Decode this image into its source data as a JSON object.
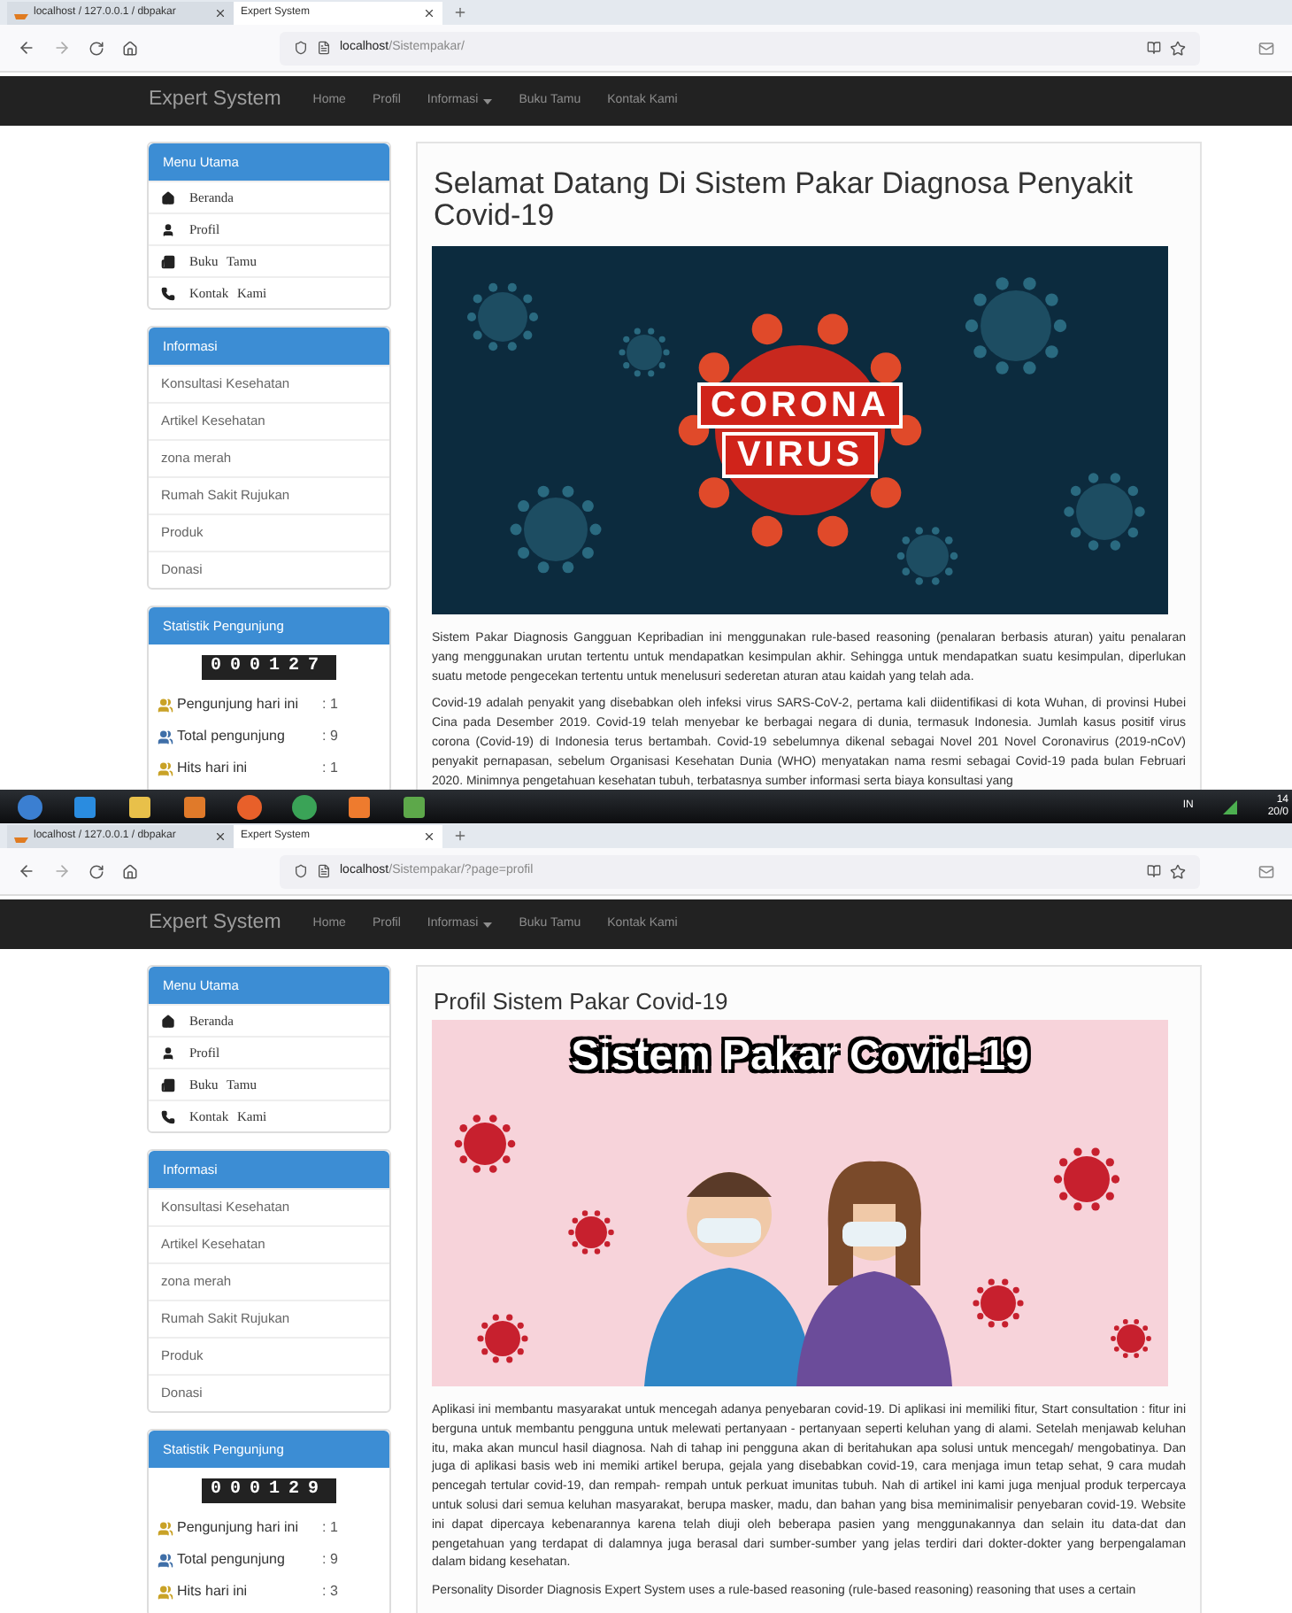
{
  "screens": [
    {
      "tabs": [
        {
          "label": "localhost / 127.0.0.1 / dbpakar",
          "selected": false
        },
        {
          "label": "Expert System",
          "selected": true
        }
      ],
      "url": {
        "host": "localhost",
        "path": "/Sistempakar/"
      },
      "navbar": {
        "brand": "Expert System",
        "links": [
          {
            "label": "Home",
            "dropdown": false
          },
          {
            "label": "Profil",
            "dropdown": false
          },
          {
            "label": "Informasi",
            "dropdown": true
          },
          {
            "label": "Buku Tamu",
            "dropdown": false
          },
          {
            "label": "Kontak Kami",
            "dropdown": false
          }
        ]
      },
      "sidebar": [
        {
          "kind": "menu",
          "title": "Menu Utama",
          "items": [
            {
              "label": "Beranda",
              "kind": "home"
            },
            {
              "label": "Profil",
              "kind": "user"
            },
            {
              "label": "Buku Tamu",
              "kind": "book"
            },
            {
              "label": "Kontak Kami",
              "kind": "phone"
            }
          ]
        },
        {
          "kind": "links",
          "title": "Informasi",
          "items": [
            {
              "label": "Konsultasi Kesehatan"
            },
            {
              "label": "Artikel Kesehatan"
            },
            {
              "label": "zona merah"
            },
            {
              "label": "Rumah Sakit Rujukan"
            },
            {
              "label": "Produk"
            },
            {
              "label": "Donasi"
            }
          ]
        },
        {
          "kind": "stats",
          "title": "Statistik Pengunjung",
          "counter": "000127",
          "rows": [
            {
              "label": "Pengunjung hari ini",
              "value": ": 1",
              "color": "#c9a227"
            },
            {
              "label": "Total pengunjung",
              "value": ": 9",
              "color": "#3f6fa8"
            },
            {
              "label": "Hits hari ini",
              "value": ": 1",
              "color": "#c9a227"
            }
          ]
        }
      ],
      "main": {
        "title": "Selamat Datang Di Sistem Pakar Diagnosa Penyakit Covid-19",
        "picture": {
          "kind": "corona",
          "text": [
            "CORONA",
            "VIRUS"
          ]
        },
        "paragraphs": [
          "Sistem Pakar Diagnosis Gangguan Kepribadian ini menggunakan rule-based reasoning (penalaran berbasis aturan) yaitu penalaran yang menggunakan urutan tertentu untuk mendapatkan kesimpulan akhir. Sehingga untuk mendapatkan suatu kesimpulan, diperlukan suatu metode pengecekan tertentu untuk menelusuri sederetan aturan atau kaidah yang telah ada.",
          "Covid-19 adalah penyakit yang disebabkan oleh infeksi virus SARS-CoV-2, pertama kali diidentifikasi di kota Wuhan, di provinsi Hubei Cina pada Desember 2019. Covid-19 telah menyebar ke berbagai negara di dunia, termasuk Indonesia. Jumlah kasus positif virus corona (Covid-19) di Indonesia terus bertambah. Covid-19 sebelumnya dikenal sebagai Novel 201 Novel Coronavirus (2019-nCoV) penyakit pernapasan, sebelum Organisasi Kesehatan Dunia (WHO) menyatakan nama resmi sebagai Covid-19 pada bulan Februari 2020. Minimnya pengetahuan kesehatan tubuh, terbatasnya sumber informasi serta biaya konsultasi yang"
        ]
      }
    },
    {
      "tabs": [
        {
          "label": "localhost / 127.0.0.1 / dbpakar",
          "selected": false
        },
        {
          "label": "Expert System",
          "selected": true
        }
      ],
      "url": {
        "host": "localhost",
        "path": "/Sistempakar/?page=profil"
      },
      "navbar": {
        "brand": "Expert System",
        "links": [
          {
            "label": "Home",
            "dropdown": false
          },
          {
            "label": "Profil",
            "dropdown": false
          },
          {
            "label": "Informasi",
            "dropdown": true
          },
          {
            "label": "Buku Tamu",
            "dropdown": false
          },
          {
            "label": "Kontak Kami",
            "dropdown": false
          }
        ]
      },
      "sidebar": [
        {
          "kind": "menu",
          "title": "Menu Utama",
          "items": [
            {
              "label": "Beranda",
              "kind": "home"
            },
            {
              "label": "Profil",
              "kind": "user"
            },
            {
              "label": "Buku Tamu",
              "kind": "book"
            },
            {
              "label": "Kontak Kami",
              "kind": "phone"
            }
          ]
        },
        {
          "kind": "links",
          "title": "Informasi",
          "items": [
            {
              "label": "Konsultasi Kesehatan"
            },
            {
              "label": "Artikel Kesehatan"
            },
            {
              "label": "zona merah"
            },
            {
              "label": "Rumah Sakit Rujukan"
            },
            {
              "label": "Produk"
            },
            {
              "label": "Donasi"
            }
          ]
        },
        {
          "kind": "stats",
          "title": "Statistik Pengunjung",
          "counter": "000129",
          "rows": [
            {
              "label": "Pengunjung hari ini",
              "value": ": 1",
              "color": "#c9a227"
            },
            {
              "label": "Total pengunjung",
              "value": ": 9",
              "color": "#3f6fa8"
            },
            {
              "label": "Hits hari ini",
              "value": ": 3",
              "color": "#c9a227"
            }
          ]
        }
      ],
      "main": {
        "title": "Profil Sistem Pakar Covid-19",
        "picture": {
          "kind": "profile",
          "text": [
            "Sistem Pakar Covid-19"
          ]
        },
        "paragraphs": [
          "Aplikasi ini membantu masyarakat untuk mencegah adanya penyebaran covid-19. Di aplikasi ini memiliki fitur, Start consultation : fitur ini berguna untuk membantu pengguna untuk melewati pertanyaan - pertanyaan seperti keluhan yang di alami. Setelah menjawab keluhan itu, maka akan muncul hasil diagnosa. Nah di tahap ini pengguna akan di beritahukan apa solusi untuk mencegah/ mengobatinya. Dan juga di aplikasi basis web ini memiki artikel berupa, gejala yang disebabkan covid-19, cara menjaga imun tetap sehat, 9 cara mudah pencegah tertular covid-19, dan rempah- rempah untuk perkuat imunitas tubuh. Nah di artikel ini kami juga menjual produk terpercaya untuk solusi dari semua keluhan masyarakat, berupa masker, madu, dan bahan yang bisa meminimalisir penyebaran covid-19. Website ini dapat dipercaya kebenarannya karena telah diuji oleh beberapa pasien yang menggunakannya dan selain itu data-dat dan pengetahuan yang terdapat di dalamnya juga berasal dari sumber-sumber yang jelas terdiri dari dokter-dokter yang berpengalaman dalam bidang kesehatan.",
          "Personality Disorder Diagnosis Expert System uses a rule-based reasoning (rule-based reasoning) reasoning that uses a certain"
        ]
      }
    }
  ],
  "taskbar": {
    "tray": "IN",
    "time": "14",
    "date": "20/0"
  }
}
